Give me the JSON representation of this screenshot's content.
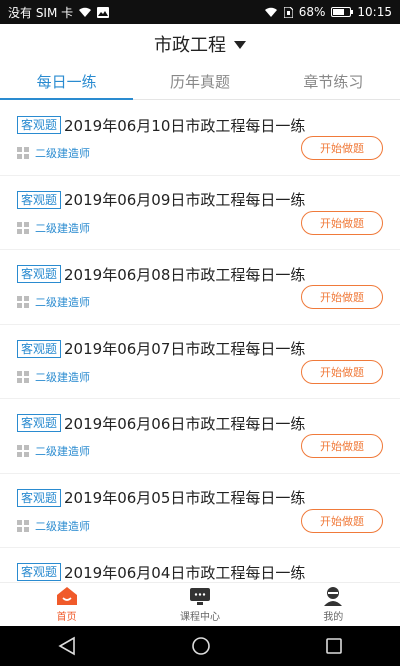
{
  "status_bar": {
    "carrier": "没有 SIM 卡",
    "battery_percent": "68%",
    "battery_level": 0.68,
    "time": "10:15"
  },
  "header": {
    "title": "市政工程"
  },
  "tabs": [
    {
      "label": "每日一练",
      "active": true
    },
    {
      "label": "历年真题",
      "active": false
    },
    {
      "label": "章节练习",
      "active": false
    }
  ],
  "items": [
    {
      "tag": "客观题",
      "title": "2019年06月10日市政工程每日一练",
      "category": "二级建造师",
      "button": "开始做题"
    },
    {
      "tag": "客观题",
      "title": "2019年06月09日市政工程每日一练",
      "category": "二级建造师",
      "button": "开始做题"
    },
    {
      "tag": "客观题",
      "title": "2019年06月08日市政工程每日一练",
      "category": "二级建造师",
      "button": "开始做题"
    },
    {
      "tag": "客观题",
      "title": "2019年06月07日市政工程每日一练",
      "category": "二级建造师",
      "button": "开始做题"
    },
    {
      "tag": "客观题",
      "title": "2019年06月06日市政工程每日一练",
      "category": "二级建造师",
      "button": "开始做题"
    },
    {
      "tag": "客观题",
      "title": "2019年06月05日市政工程每日一练",
      "category": "二级建造师",
      "button": "开始做题"
    },
    {
      "tag": "客观题",
      "title": "2019年06月04日市政工程每日一练",
      "category": "",
      "button": ""
    }
  ],
  "bottom_nav": [
    {
      "label": "首页",
      "icon": "home-icon",
      "active": true
    },
    {
      "label": "课程中心",
      "icon": "course-center-icon",
      "active": false
    },
    {
      "label": "我的",
      "icon": "profile-icon",
      "active": false
    }
  ],
  "colors": {
    "accent": "#2a8bd0",
    "orange": "#f07a3a",
    "active_nav": "#f05a2a"
  }
}
